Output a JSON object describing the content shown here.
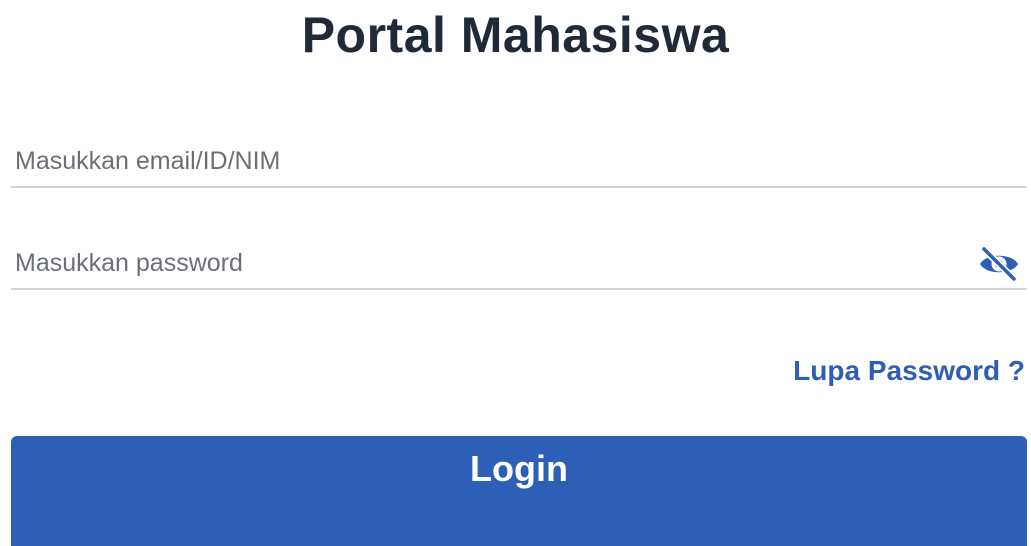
{
  "page": {
    "title": "Portal Mahasiswa"
  },
  "form": {
    "email_placeholder": "Masukkan email/ID/NIM",
    "email_value": "",
    "password_placeholder": "Masukkan password",
    "password_value": "",
    "password_toggle_icon": "eye-off-icon",
    "forgot_password_label": "Lupa Password ?",
    "login_label": "Login"
  },
  "colors": {
    "primary": "#2c5fb5",
    "link": "#2d5fb6",
    "title_text": "#1f2937",
    "divider": "#d4d4dc",
    "background": "#ffffff"
  }
}
